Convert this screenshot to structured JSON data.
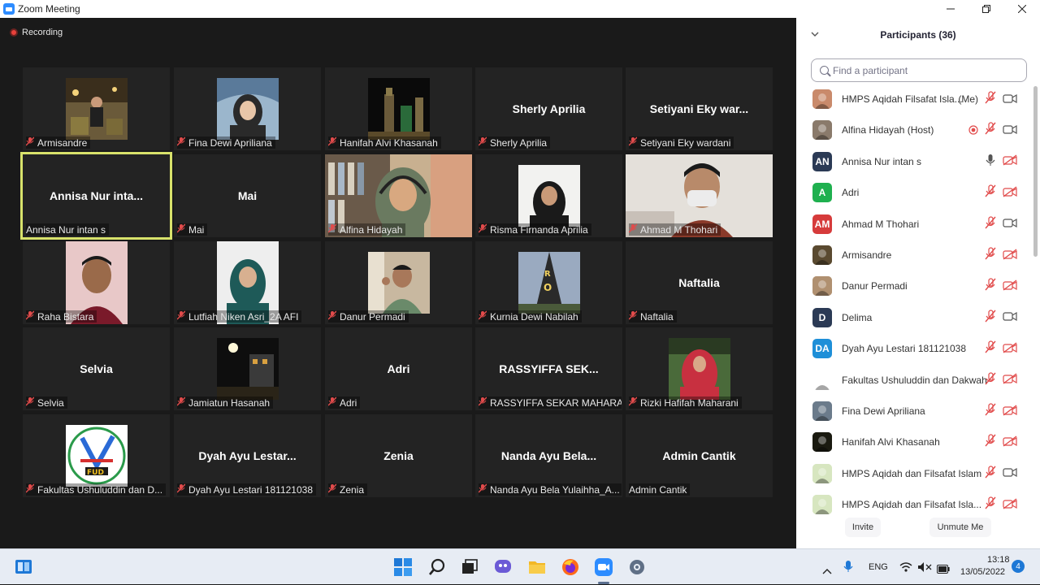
{
  "window": {
    "title": "Zoom Meeting"
  },
  "recording": {
    "label": "Recording"
  },
  "tiles": [
    {
      "name": "Armisandre",
      "big": "",
      "photo": "p1"
    },
    {
      "name": "Fina Dewi Apriliana",
      "big": "",
      "photo": "p2"
    },
    {
      "name": "Hanifah Alvi Khasanah",
      "big": "",
      "photo": "p3"
    },
    {
      "name": "Sherly Aprilia",
      "big": "Sherly Aprilia",
      "photo": ""
    },
    {
      "name": "Setiyani Eky wardani",
      "big": "Setiyani Eky war...",
      "photo": ""
    },
    {
      "name": "Annisa Nur intan s",
      "big": "Annisa Nur inta...",
      "photo": "",
      "speaking": true,
      "unmuted": true
    },
    {
      "name": "Mai",
      "big": "Mai",
      "photo": ""
    },
    {
      "name": "Alfina Hidayah",
      "big": "",
      "photo": "p4full"
    },
    {
      "name": "Risma Firnanda Aprilia",
      "big": "",
      "photo": "p5"
    },
    {
      "name": "Ahmad M Thohari",
      "big": "",
      "photo": "p6full"
    },
    {
      "name": "Raha Bistara",
      "big": "",
      "photo": "p7"
    },
    {
      "name": "Lutfiah Niken Asri_2A AFI",
      "big": "",
      "photo": "p8"
    },
    {
      "name": "Danur Permadi",
      "big": "",
      "photo": "p9"
    },
    {
      "name": "Kurnia Dewi Nabilah",
      "big": "",
      "photo": "p10"
    },
    {
      "name": "Naftalia",
      "big": "Naftalia",
      "photo": ""
    },
    {
      "name": "Selvia",
      "big": "Selvia",
      "photo": ""
    },
    {
      "name": "Jamiatun Hasanah",
      "big": "",
      "photo": "p11"
    },
    {
      "name": "Adri",
      "big": "Adri",
      "photo": ""
    },
    {
      "name": "RASSYIFFA SEKAR MAHARA...",
      "big": "RASSYIFFA SEK...",
      "photo": ""
    },
    {
      "name": "Rizki Hafifah Maharani",
      "big": "",
      "photo": "p12"
    },
    {
      "name": "Fakultas Ushuluddin dan D...",
      "big": "",
      "photo": "logo"
    },
    {
      "name": "Dyah Ayu Lestari 181121038",
      "big": "Dyah Ayu Lestar...",
      "photo": ""
    },
    {
      "name": "Zenia",
      "big": "Zenia",
      "photo": ""
    },
    {
      "name": "Nanda Ayu Bela Yulaihha_A...",
      "big": "Nanda Ayu Bela...",
      "photo": ""
    },
    {
      "name": "Admin Cantik",
      "big": "Admin Cantik",
      "photo": "",
      "nomute": true
    }
  ],
  "participants": {
    "title": "Participants (36)",
    "search_placeholder": "Find a participant",
    "list": [
      {
        "name": "HMPS Aqidah Filsafat Isla...",
        "suffix": "(Me)",
        "avatar": "img",
        "color": "#c98a6b",
        "mic": "off",
        "video": "on"
      },
      {
        "name": "Alfina Hidayah (Host)",
        "avatar": "img",
        "color": "#8a7a6b",
        "mic": "off",
        "video": "on",
        "rec": true
      },
      {
        "name": "Annisa Nur intan s",
        "avatar": "AN",
        "color": "#2b3a55",
        "mic": "on",
        "video": "off"
      },
      {
        "name": "Adri",
        "avatar": "A",
        "color": "#1fb04f",
        "mic": "off",
        "video": "off"
      },
      {
        "name": "Ahmad M Thohari",
        "avatar": "AM",
        "color": "#d63b3b",
        "mic": "off",
        "video": "on"
      },
      {
        "name": "Armisandre",
        "avatar": "img",
        "color": "#5a4a30",
        "mic": "off",
        "video": "off"
      },
      {
        "name": "Danur Permadi",
        "avatar": "img",
        "color": "#b09070",
        "mic": "off",
        "video": "off"
      },
      {
        "name": "Delima",
        "avatar": "D",
        "color": "#2b3a55",
        "mic": "off",
        "video": "on"
      },
      {
        "name": "Dyah Ayu Lestari 181121038",
        "avatar": "DA",
        "color": "#1e8fd8",
        "mic": "off",
        "video": "off"
      },
      {
        "name": "Fakultas Ushuluddin dan Dakwah",
        "avatar": "img",
        "color": "#ffffff",
        "mic": "off",
        "video": "off"
      },
      {
        "name": "Fina Dewi Apriliana",
        "avatar": "img",
        "color": "#6b7b8b",
        "mic": "off",
        "video": "off"
      },
      {
        "name": "Hanifah Alvi Khasanah",
        "avatar": "img",
        "color": "#1a1a10",
        "mic": "off",
        "video": "off"
      },
      {
        "name": "HMPS Aqidah dan Filsafat Islam",
        "avatar": "img",
        "color": "#d7e6c0",
        "mic": "off",
        "video": "on"
      },
      {
        "name": "HMPS Aqidah dan Filsafat Isla...",
        "avatar": "img",
        "color": "#d7e6c0",
        "mic": "off",
        "video": "off"
      }
    ],
    "invite_label": "Invite",
    "unmute_label": "Unmute Me"
  },
  "taskbar": {
    "lang": "ENG",
    "time": "13:18",
    "date": "13/05/2022",
    "notification_count": "4"
  }
}
